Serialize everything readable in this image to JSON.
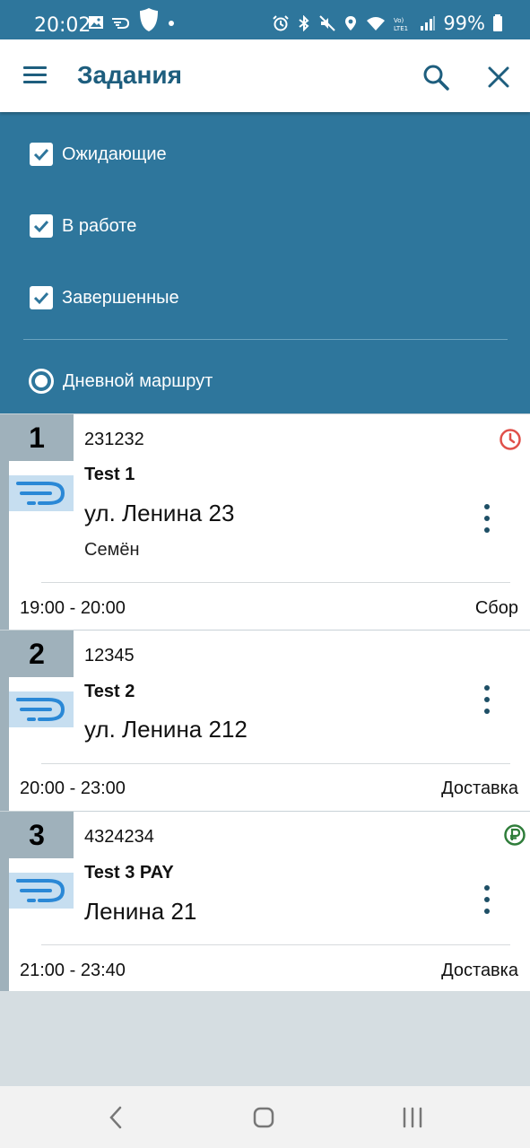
{
  "status_bar": {
    "time": "20:02",
    "battery": "99%",
    "left_icons": [
      "image-icon",
      "cast-icon",
      "shield-app-icon",
      "dot-icon"
    ],
    "right_icons": [
      "alarm-icon",
      "bluetooth-icon",
      "mute-icon",
      "location-icon",
      "wifi-icon",
      "lte-icon",
      "signal-icon",
      "battery-icon"
    ]
  },
  "appbar": {
    "title": "Задания",
    "icons": [
      "menu-icon",
      "search-icon",
      "close-icon"
    ]
  },
  "filters": {
    "checkboxes": [
      {
        "label": "Ожидающие",
        "checked": true
      },
      {
        "label": "В работе",
        "checked": true
      },
      {
        "label": "Завершенные",
        "checked": true
      }
    ],
    "radio": {
      "label": "Дневной маршрут",
      "selected": true
    }
  },
  "tasks": [
    {
      "number": "1",
      "code": "231232",
      "name": "Test 1",
      "address": "ул. Ленина 23",
      "person": "Семён",
      "time_range": "19:00 - 20:00",
      "type": "Сбор",
      "status_icon": "clock-icon",
      "status_color": "#e0504a"
    },
    {
      "number": "2",
      "code": "12345",
      "name": "Test 2",
      "address": "ул. Ленина 212",
      "person": "",
      "time_range": "20:00 - 23:00",
      "type": "Доставка",
      "status_icon": "",
      "status_color": ""
    },
    {
      "number": "3",
      "code": "4324234",
      "name": "Test 3 PAY",
      "address": "Ленина 21",
      "person": "",
      "time_range": "21:00 - 23:40",
      "type": "Доставка",
      "status_icon": "ruble-icon",
      "status_color": "#2f7d3a"
    }
  ],
  "colors": {
    "primary": "#2e769c",
    "title": "#1e5e7e",
    "number_box": "#9fb1bb",
    "background": "#d5dde1"
  },
  "navbar": {
    "icons": [
      "back-icon",
      "home-icon",
      "recents-icon"
    ]
  }
}
